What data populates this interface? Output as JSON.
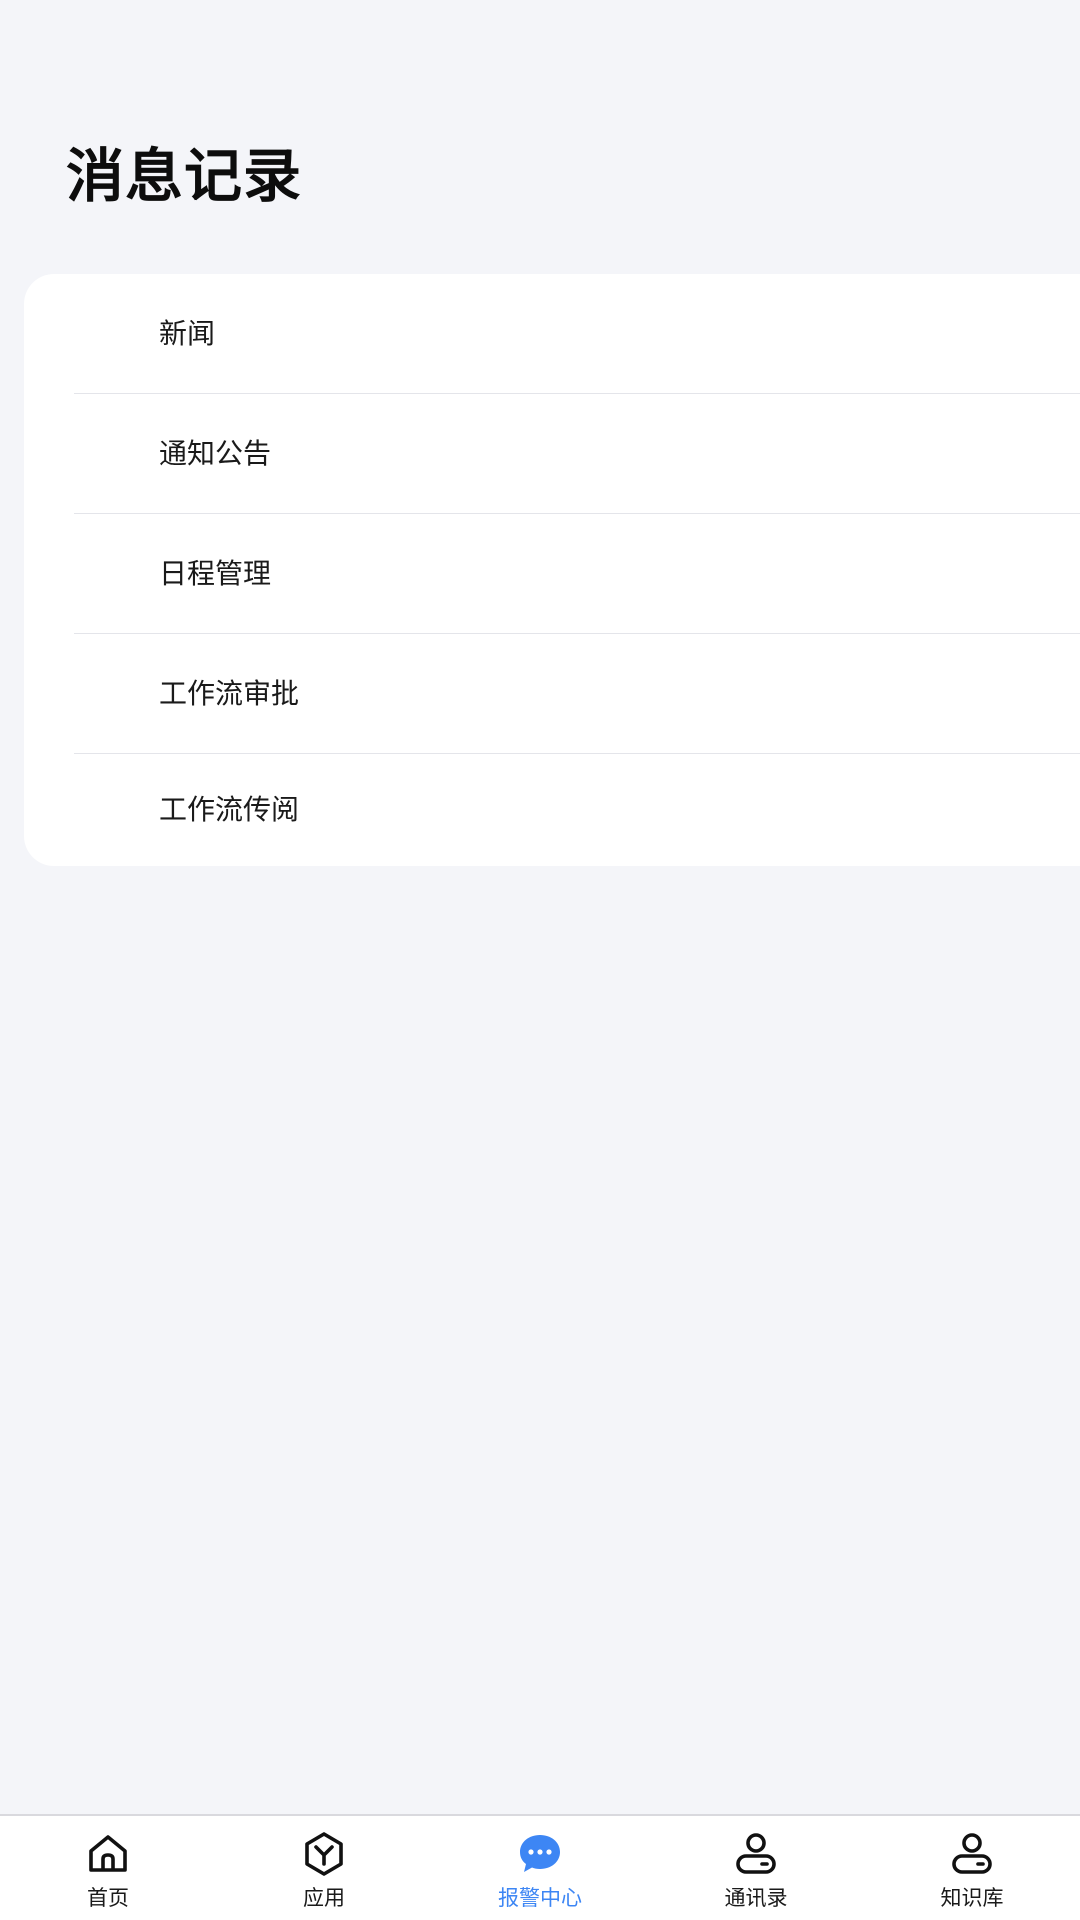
{
  "header": {
    "title": "消息记录"
  },
  "message_list": {
    "items": [
      {
        "label": "新闻"
      },
      {
        "label": "通知公告"
      },
      {
        "label": "日程管理"
      },
      {
        "label": "工作流审批"
      },
      {
        "label": "工作流传阅"
      }
    ]
  },
  "tab_bar": {
    "active_color": "#3d86f4",
    "inactive_color": "#1a1a1a",
    "active_index": 2,
    "items": [
      {
        "label": "首页",
        "icon": "home-icon"
      },
      {
        "label": "应用",
        "icon": "hexagon-app-icon"
      },
      {
        "label": "报警中心",
        "icon": "chat-bubble-icon"
      },
      {
        "label": "通讯录",
        "icon": "contact-person-icon"
      },
      {
        "label": "知识库",
        "icon": "contact-person-icon"
      }
    ]
  }
}
